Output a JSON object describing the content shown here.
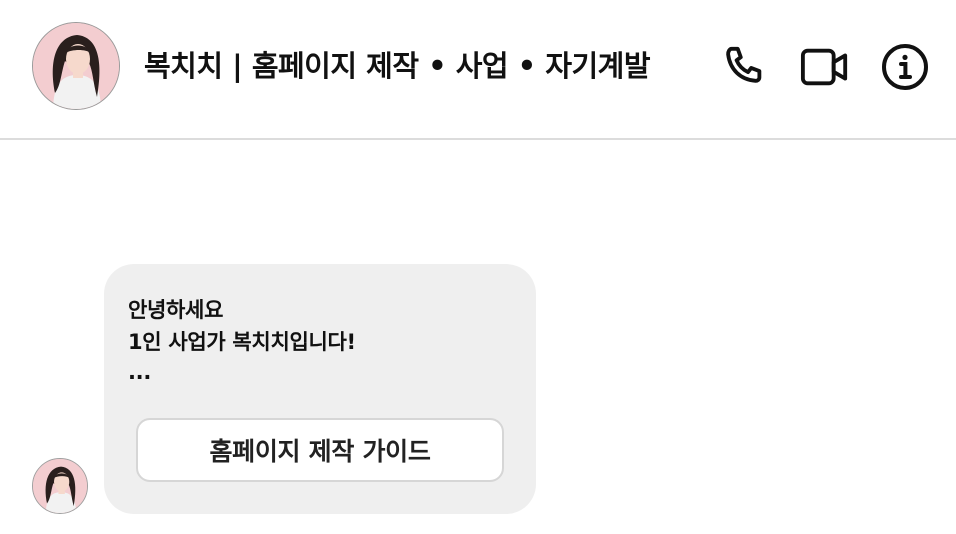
{
  "header": {
    "title": "복치치 | 홈페이지 제작 • 사업 • 자기계발",
    "avatar_icon": "profile-photo",
    "actions": [
      {
        "icon": "phone-icon"
      },
      {
        "icon": "video-camera-icon"
      },
      {
        "icon": "info-icon"
      }
    ]
  },
  "message": {
    "lines": [
      "안녕하세요",
      "1인 사업가 복치치입니다!",
      "..."
    ],
    "button_label": "홈페이지 제작 가이드"
  },
  "colors": {
    "bubble": "#efefef",
    "divider": "#dcdcdc",
    "avatar_bg": "#f1c9cc"
  }
}
